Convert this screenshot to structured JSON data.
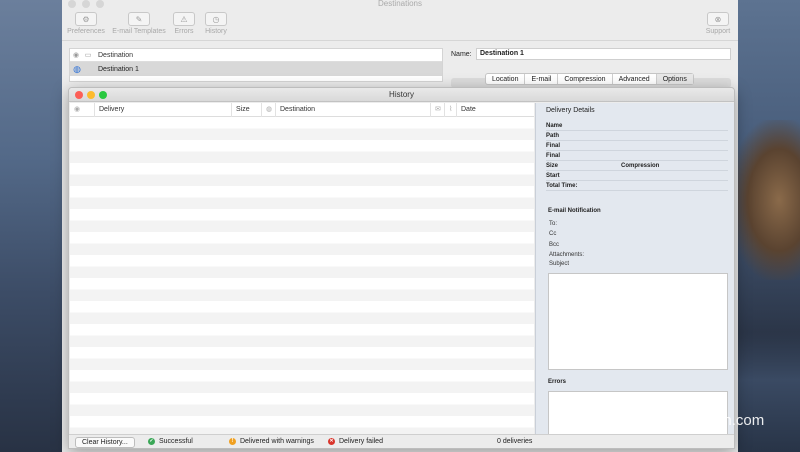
{
  "main_window": {
    "title": "Destinations",
    "toolbar": [
      {
        "label": "Preferences",
        "icon": "gear-icon",
        "glyph": "⚙"
      },
      {
        "label": "E-mail Templates",
        "icon": "pencil-icon",
        "glyph": "✎"
      },
      {
        "label": "Errors",
        "icon": "warning-icon",
        "glyph": "⚠"
      },
      {
        "label": "History",
        "icon": "clock-icon",
        "glyph": "◷"
      },
      {
        "label": "Support",
        "icon": "lifebuoy-icon",
        "glyph": "⊗"
      }
    ],
    "destination_list": {
      "header": "Destination",
      "items": [
        "Destination 1"
      ]
    },
    "name_label": "Name:",
    "name_value": "Destination 1",
    "tabs": [
      "Location",
      "E-mail",
      "Compression",
      "Advanced",
      "Options"
    ]
  },
  "history_window": {
    "title": "History",
    "columns": [
      "Delivery",
      "Size",
      "Destination",
      "Date"
    ],
    "details": {
      "title": "Delivery Details",
      "rows": [
        {
          "label": "Name",
          "second": ""
        },
        {
          "label": "Path",
          "second": ""
        },
        {
          "label": "Final",
          "second": ""
        },
        {
          "label": "Final",
          "second": ""
        },
        {
          "label": "Size",
          "second": "Compression"
        },
        {
          "label": "Start",
          "second": ""
        },
        {
          "label": "Total Time:",
          "second": ""
        }
      ],
      "email_title": "E-mail Notification",
      "email_fields": [
        "To:",
        "Cc",
        "Bcc",
        "Attachments:",
        "Subject"
      ],
      "errors_title": "Errors"
    },
    "status": {
      "clear_button": "Clear History...",
      "successful": "Successful",
      "warnings": "Delivered with warnings",
      "failed": "Delivery failed",
      "count": "0 deliveries"
    }
  },
  "colors": {
    "success": "#3aa757",
    "warning": "#f0a020",
    "failed": "#d9342b",
    "close": "#fc5f57",
    "minimize": "#fdbb2e",
    "zoom": "#29c840"
  },
  "watermark": "Yuucn.com"
}
